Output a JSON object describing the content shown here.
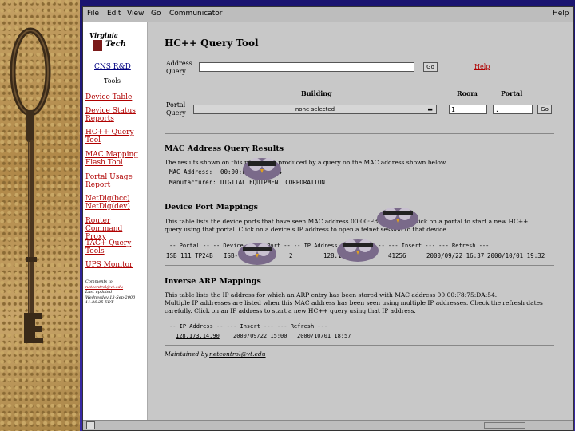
{
  "menu": [
    "File",
    "Edit",
    "View",
    "Go",
    "Communicator"
  ],
  "help_menu": "Help",
  "logo": {
    "line1": "Virginia",
    "line2": "Tech"
  },
  "nav": {
    "header_link": "CNS R&D",
    "tools_label": "Tools",
    "items": [
      {
        "line1": "Device Table",
        "line2": ""
      },
      {
        "line1": "Device Status",
        "line2": "Reports"
      },
      {
        "line1": "HC++ Query",
        "line2": "Tool"
      },
      {
        "line1": "MAC Mapping",
        "line2": "Flash Tool"
      },
      {
        "line1": "Portal Usage",
        "line2": "Report"
      },
      {
        "line1": "NetDig(bcc)",
        "line2": "NetDig(dev)"
      },
      {
        "line1": "Router Command",
        "line2": "Proxy"
      },
      {
        "line1": "TAC+ Query",
        "line2": "Tools"
      },
      {
        "line1": "UPS Monitor",
        "line2": ""
      }
    ],
    "footer": [
      "Comments to",
      "netcontrol@vt.edu",
      "Last updated",
      "Wednesday 13-Sep-2000",
      "11:36:25 EDT"
    ]
  },
  "page_title": "HC++ Query Tool",
  "address_query": {
    "label1": "Address",
    "label2": "Query",
    "value": "",
    "go": "Go",
    "help": "Help"
  },
  "portal_query": {
    "label1": "Portal",
    "label2": "Query",
    "building_header": "Building",
    "room_header": "Room",
    "portal_header": "Portal",
    "building_selected": "none selected",
    "room_value": "1",
    "portal_value": ".",
    "go": "Go"
  },
  "results": {
    "title": "MAC Address Query Results",
    "intro": "The results shown on this page were produced by a query on the MAC address shown below.",
    "mac_label": "MAC Address:",
    "mac_value": "00:00:F8:75:DA:54",
    "mfr_label": "Manufacturer:",
    "mfr_value": "DIGITAL EQUIPMENT CORPORATION"
  },
  "device_ports": {
    "title": "Device Port Mappings",
    "desc1": "This table lists the device ports that have seen MAC address 00:00:F8:75:DA:54. Click on a portal to start a new HC++",
    "desc2": "query using that portal. Click on a device's IP address to open a telnet session to that device.",
    "header": "-- Portal --    -- Device --    -- Port --   -- IP Address --   -- COOB --    --- Insert ---    --- Refresh ---",
    "row": {
      "portal": "ISB 111 TP24B",
      "device": "ISB-",
      "port": "2",
      "ip": "128.173",
      "coob": "41256",
      "insert": "2000/09/22 16:37",
      "refresh": "2000/10/01 19:32"
    }
  },
  "arp": {
    "title": "Inverse ARP Mappings",
    "desc1": "This table lists the IP address for which an ARP entry has been stored with MAC address 00:00:F8:75:DA:54.",
    "desc2": "Multiple IP addresses are listed when this MAC address has been seen using multiple IP addresses. Check the refresh dates",
    "desc3": "carefully. Click on an IP address to start a new HC++ query using that IP address.",
    "header": "-- IP Address --    --- Insert ---    --- Refresh ---",
    "row": {
      "ip": "128.173.14.90",
      "insert": "2000/09/22 15:00",
      "refresh": "2000/10/01 18:57"
    }
  },
  "maintained": {
    "label": "Maintained by",
    "email": "netcontrol@vt.edu"
  }
}
